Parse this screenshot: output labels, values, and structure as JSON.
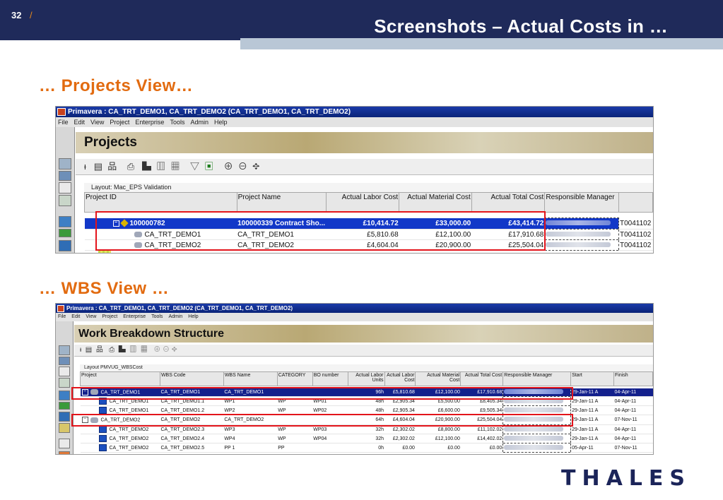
{
  "slide": {
    "number": "32",
    "slash": "/",
    "title": "Screenshots – Actual Costs in …",
    "section_projects": "… Projects View…",
    "section_wbs": "… WBS View …",
    "logo": "THALES"
  },
  "projects_window": {
    "title": "Primavera : CA_TRT_DEMO1, CA_TRT_DEMO2 (CA_TRT_DEMO1, CA_TRT_DEMO2)",
    "menu": [
      "File",
      "Edit",
      "View",
      "Project",
      "Enterprise",
      "Tools",
      "Admin",
      "Help"
    ],
    "banner": "Projects",
    "layout_label": "Layout: Mac_EPS Validation",
    "columns": [
      "Project ID",
      "Project Name",
      "Actual Labor Cost",
      "Actual Material Cost",
      "Actual Total Cost",
      "Responsible Manager",
      ""
    ],
    "rows": [
      {
        "id": "100000782",
        "name": "100000339 Contract Sho...",
        "labor": "£10,414.72",
        "material": "£33,000.00",
        "total": "£43,414.72",
        "manager": "",
        "code": "T0041102"
      },
      {
        "id": "CA_TRT_DEMO1",
        "name": "CA_TRT_DEMO1",
        "labor": "£5,810.68",
        "material": "£12,100.00",
        "total": "£17,910.68",
        "manager": "",
        "code": "T0041102"
      },
      {
        "id": "CA_TRT_DEMO2",
        "name": "CA_TRT_DEMO2",
        "labor": "£4,604.04",
        "material": "£20,900.00",
        "total": "£25,504.04",
        "manager": "",
        "code": "T0041102"
      }
    ]
  },
  "wbs_window": {
    "title": "Primavera : CA_TRT_DEMO1, CA_TRT_DEMO2 (CA_TRT_DEMO1, CA_TRT_DEMO2)",
    "menu": [
      "File",
      "Edit",
      "View",
      "Project",
      "Enterprise",
      "Tools",
      "Admin",
      "Help"
    ],
    "banner": "Work Breakdown Structure",
    "layout_label": "Layout PMVUG_WBSCost",
    "columns": [
      "Project",
      "WBS Code",
      "WBS Name",
      "CATEGORY",
      "BO number",
      "Actual Labor Units",
      "Actual Labor Cost",
      "Actual Material Cost",
      "Actual Total Cost",
      "Responsible Manager",
      "Start",
      "Finish"
    ],
    "rows": [
      {
        "project": "CA_TRT_DEMO1",
        "code": "CA_TRT_DEMO1",
        "name": "CA_TRT_DEMO1",
        "cat": "",
        "bo": "",
        "units": "96h",
        "labor": "£5,810.68",
        "material": "£12,100.00",
        "total": "£17,910.68",
        "start": "29-Jan-11 A",
        "finish": "04-Apr-11"
      },
      {
        "project": "CA_TRT_DEMO1",
        "code": "CA_TRT_DEMO1.1",
        "name": "WP1",
        "cat": "WP",
        "bo": "WP01",
        "units": "48h",
        "labor": "£2,905.34",
        "material": "£5,500.00",
        "total": "£8,405.34",
        "start": "29-Jan-11 A",
        "finish": "04-Apr-11"
      },
      {
        "project": "CA_TRT_DEMO1",
        "code": "CA_TRT_DEMO1.2",
        "name": "WP2",
        "cat": "WP",
        "bo": "WP02",
        "units": "48h",
        "labor": "£2,905.34",
        "material": "£6,600.00",
        "total": "£9,505.34",
        "start": "29-Jan-11 A",
        "finish": "04-Apr-11"
      },
      {
        "project": "CA_TRT_DEMO2",
        "code": "CA_TRT_DEMO2",
        "name": "CA_TRT_DEMO2",
        "cat": "",
        "bo": "",
        "units": "64h",
        "labor": "£4,604.04",
        "material": "£20,900.00",
        "total": "£25,504.04",
        "start": "29-Jan-11 A",
        "finish": "07-Nov-11"
      },
      {
        "project": "CA_TRT_DEMO2",
        "code": "CA_TRT_DEMO2.3",
        "name": "WP3",
        "cat": "WP",
        "bo": "WP03",
        "units": "32h",
        "labor": "£2,302.02",
        "material": "£8,800.00",
        "total": "£11,102.02",
        "start": "29-Jan-11 A",
        "finish": "04-Apr-11"
      },
      {
        "project": "CA_TRT_DEMO2",
        "code": "CA_TRT_DEMO2.4",
        "name": "WP4",
        "cat": "WP",
        "bo": "WP04",
        "units": "32h",
        "labor": "£2,302.02",
        "material": "£12,100.00",
        "total": "£14,402.02",
        "start": "29-Jan-11 A",
        "finish": "04-Apr-11"
      },
      {
        "project": "CA_TRT_DEMO2",
        "code": "CA_TRT_DEMO2.5",
        "name": "PP 1",
        "cat": "PP",
        "bo": "",
        "units": "0h",
        "labor": "£0.00",
        "material": "£0.00",
        "total": "£0.00",
        "start": "05-Apr-11",
        "finish": "07-Nov-11"
      }
    ]
  }
}
